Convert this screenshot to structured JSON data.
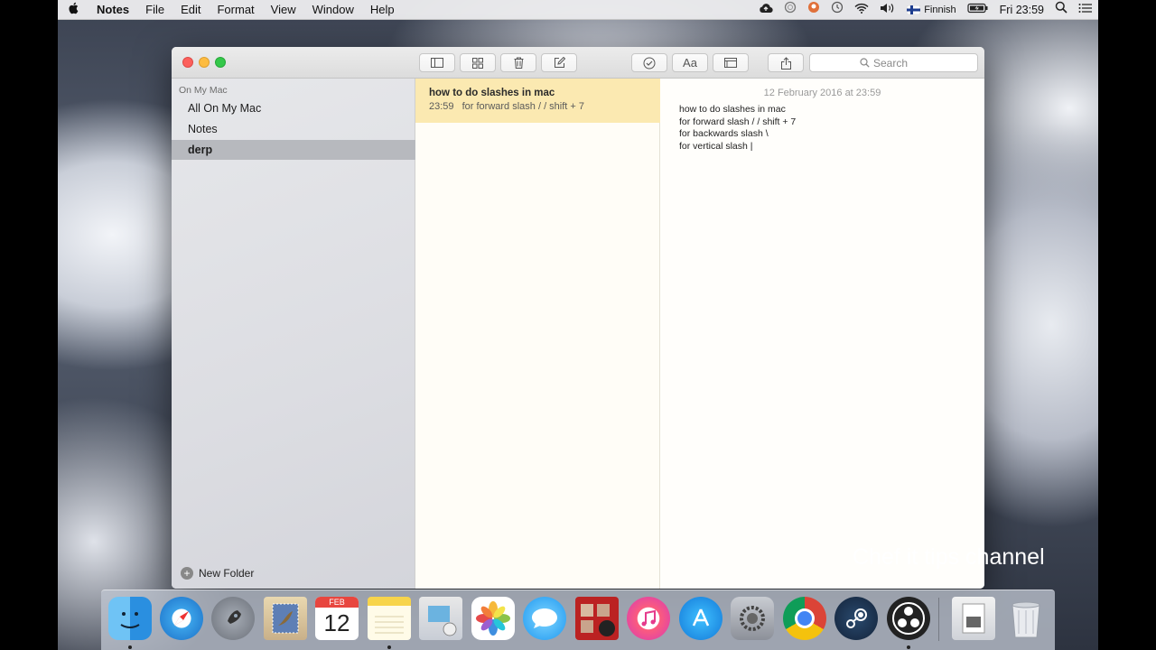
{
  "menubar": {
    "apple_icon": "apple-icon",
    "app_name": "Notes",
    "menus": [
      "File",
      "Edit",
      "Format",
      "View",
      "Window",
      "Help"
    ],
    "status": {
      "input_source": "Finnish",
      "clock": "Fri 23:59",
      "icons": [
        "cloud-upload-icon",
        "sync-icon",
        "user-icon",
        "time-machine-icon",
        "wifi-icon",
        "volume-icon",
        "flag-icon",
        "battery-icon",
        "search-icon",
        "list-icon"
      ]
    }
  },
  "window": {
    "toolbar": {
      "search_placeholder": "Search",
      "icons": [
        "sidebar-toggle-icon",
        "attachments-grid-icon",
        "trash-icon",
        "compose-icon",
        "checklist-icon",
        "format-icon",
        "table-icon",
        "share-icon"
      ],
      "format_label": "Aa"
    },
    "sidebar": {
      "heading": "On My Mac",
      "items": [
        {
          "label": "All On My Mac",
          "selected": false
        },
        {
          "label": "Notes",
          "selected": false
        },
        {
          "label": "derp",
          "selected": true
        }
      ],
      "new_folder_label": "New Folder"
    },
    "note_list": {
      "items": [
        {
          "title": "how to do slashes in mac",
          "time": "23:59",
          "preview": "for forward slash / / shift + 7"
        }
      ]
    },
    "editor": {
      "date": "12 February 2016 at 23:59",
      "lines": [
        "how to do slashes in mac",
        "for forward slash / / shift + 7",
        "for backwards slash \\",
        "for vertical slash |"
      ]
    }
  },
  "watermark": "Chef it tips channel",
  "dock": {
    "apps": [
      "Finder",
      "Safari",
      "Launchpad",
      "Mail",
      "Calendar",
      "Notes",
      "Preview",
      "Photos",
      "Messages",
      "Photo Booth",
      "iTunes",
      "App Store",
      "System Preferences",
      "Chrome",
      "Steam",
      "OBS",
      "Downloads",
      "Trash"
    ],
    "calendar_month": "FEB",
    "calendar_day": "12",
    "colors": {
      "notes_highlight": "#fbe9b1",
      "sidebar_selected": "#b7b9be"
    }
  }
}
